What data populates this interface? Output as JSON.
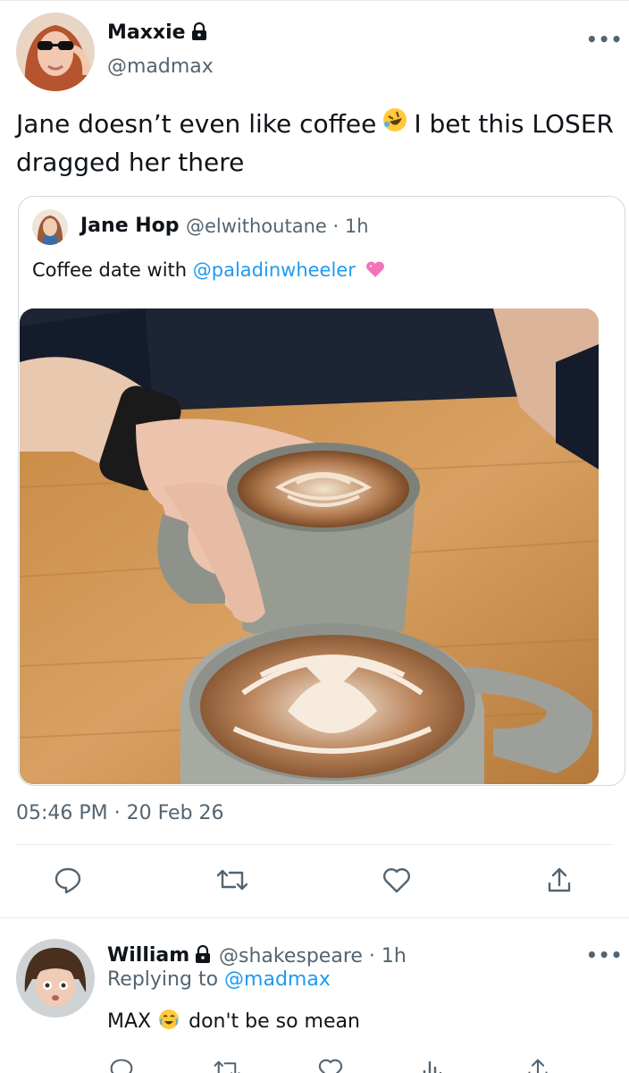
{
  "tweet": {
    "author_name": "Maxxie",
    "author_handle": "@madmax",
    "text_part1": "Jane doesn’t even like coffee",
    "emoji_1": "rolling-on-floor-laughing-emoji",
    "text_part2": "I bet this LOSER dragged her there",
    "timestamp": "05:46 PM · 20 Feb 26",
    "more_label": "•••"
  },
  "quoted_tweet": {
    "author_name": "Jane Hop",
    "author_handle": "@elwithoutane",
    "time": "1h",
    "separator": "·",
    "text": "Coffee date with",
    "mention": "@paladinwheeler",
    "emoji": "pink-heart-emoji",
    "image": "two-latte-art-coffee-cups-on-table"
  },
  "actions": [
    "reply-icon",
    "retweet-icon",
    "like-icon",
    "share-icon"
  ],
  "reply": {
    "author_name": "William",
    "author_handle": "@shakespeare",
    "time": "1h",
    "separator": "·",
    "replying_to_label": "Replying to",
    "replying_to_handle": "@madmax",
    "text_part1": "MAX",
    "emoji": "crying-laughing-emoji",
    "text_part2": "don't be so mean",
    "more_label": "•••"
  },
  "colors": {
    "accent": "#1d9bf0",
    "secondary_text": "#536471",
    "border": "#cfd9de"
  }
}
